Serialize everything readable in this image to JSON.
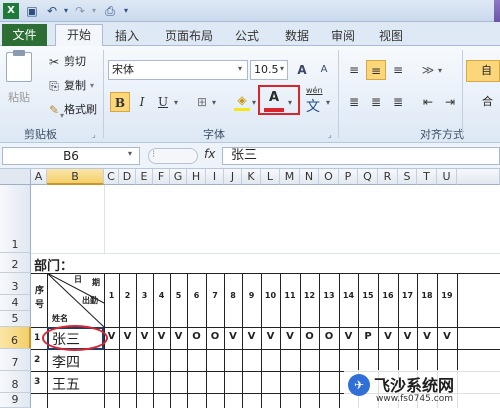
{
  "titlebar": {
    "undo_icon": "↶",
    "redo_icon": "↷"
  },
  "tabs": [
    "文件",
    "开始",
    "插入",
    "页面布局",
    "公式",
    "数据",
    "审阅",
    "视图"
  ],
  "clipboard": {
    "paste": "粘贴",
    "cut": "剪切",
    "copy": "复制",
    "format_painter": "格式刷",
    "label": "剪贴板"
  },
  "font": {
    "name": "宋体",
    "size": "10.5",
    "grow": "A",
    "shrink": "A",
    "bold": "B",
    "italic": "I",
    "underline": "U",
    "label": "字体",
    "font_color_letter": "A",
    "phonetic": "wén",
    "phonetic_char": "文"
  },
  "alignment": {
    "label": "对齐方式",
    "wrap": "自",
    "merge": "合"
  },
  "formula_bar": {
    "cell_ref": "B6",
    "fx": "fx",
    "value": "张三"
  },
  "columns": [
    "A",
    "B",
    "C",
    "D",
    "E",
    "F",
    "G",
    "H",
    "I",
    "J",
    "K",
    "L",
    "M",
    "N",
    "O",
    "P",
    "Q",
    "R",
    "S",
    "T",
    "U"
  ],
  "rows": [
    "1",
    "2",
    "3",
    "4",
    "5",
    "6",
    "7",
    "8",
    "9"
  ],
  "sheet": {
    "dept_label": "部门：",
    "seq_label_1": "序",
    "seq_label_2": "号",
    "date_label_1": "日",
    "date_label_2": "期",
    "attend_label": "出勤",
    "name_header": "姓名",
    "days": [
      "1",
      "2",
      "3",
      "4",
      "5",
      "6",
      "7",
      "8",
      "9",
      "10",
      "11",
      "12",
      "13",
      "14",
      "15",
      "16",
      "17",
      "18",
      "19"
    ],
    "records": [
      {
        "seq": "1",
        "name": "张三",
        "values": [
          "V",
          "V",
          "V",
          "V",
          "V",
          "O",
          "O",
          "V",
          "V",
          "V",
          "V",
          "O",
          "O",
          "V",
          "P",
          "V",
          "V",
          "V",
          "V"
        ]
      },
      {
        "seq": "2",
        "name": "李四",
        "values": []
      },
      {
        "seq": "3",
        "name": "王五",
        "values": []
      }
    ]
  },
  "watermark": {
    "brand": "飞沙系统网",
    "url": "www.fs0745.com"
  },
  "colors": {
    "file_tab": "#2d6e34",
    "highlight": "#d9262c",
    "selection": "#1f3b6b"
  }
}
